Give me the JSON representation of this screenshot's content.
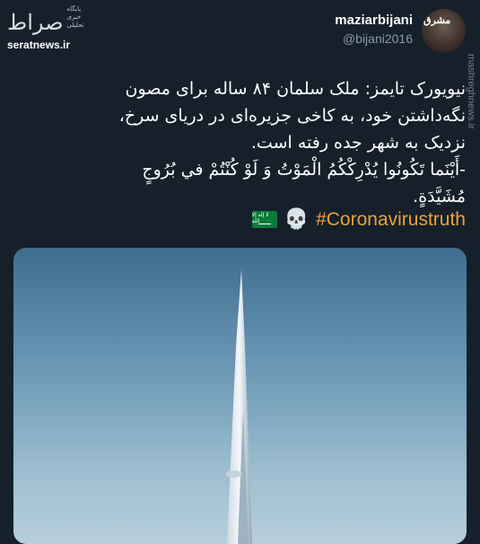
{
  "watermark": {
    "logo": "صراط",
    "logo_sub": "پایگاه خبری تحلیلی",
    "site": "seratnews.ir"
  },
  "author": {
    "display_name": "maziarbijani",
    "handle": "@bijani2016"
  },
  "side_watermark": "mashreghnews.ir",
  "tweet": {
    "lines": [
      "نیویورک تایمز: ملک سلمان ۸۴ ساله برای مصون",
      "نگه‌داشتن خود، به کاخی جزیره‌ای در دریای سرخ،",
      "نزدیک به شهر جده رفته است.",
      "-أَيْنَما تَكُونُوا يُدْرِكْكُمُ الْمَوْتُ وَ لَوْ كُنْتُمْ في بُرُوجٍ",
      "مُشَيَّدَةٍ."
    ],
    "hashtag": "#Coronavirustruth",
    "emojis": [
      "skull-icon",
      "saudi-flag-icon"
    ]
  },
  "colors": {
    "background": "#15202b",
    "hashtag": "#e8a33a",
    "muted": "#8899a6"
  }
}
